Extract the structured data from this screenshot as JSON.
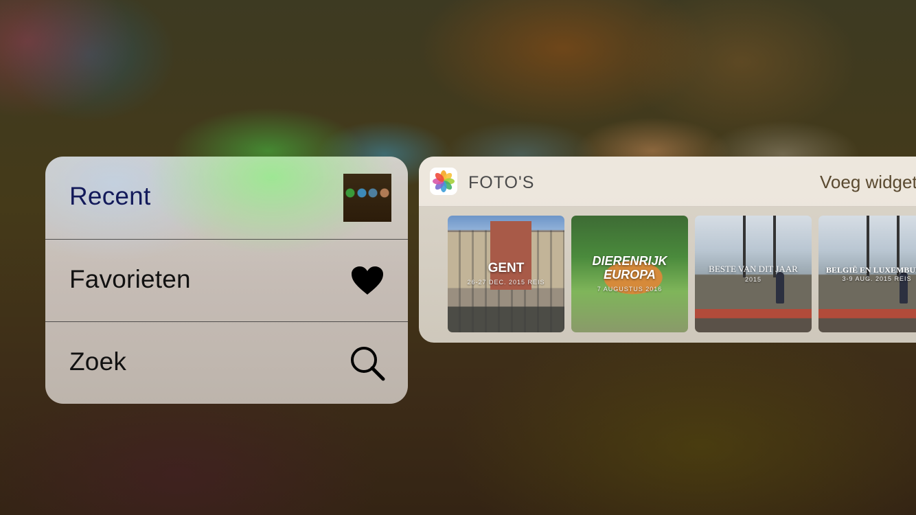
{
  "menu": {
    "items": [
      {
        "label": "Recent",
        "icon": "recent-photo-thumbnail"
      },
      {
        "label": "Favorieten",
        "icon": "heart-icon"
      },
      {
        "label": "Zoek",
        "icon": "search-icon"
      }
    ]
  },
  "widget": {
    "app_name": "FOTO'S",
    "action_label": "Voeg widget toe",
    "albums": [
      {
        "title": "GENT",
        "subtitle": "26-27 DEC. 2015 REIS"
      },
      {
        "title": "DIERENRIJK EUROPA",
        "subtitle": "7 AUGUSTUS 2016"
      },
      {
        "title": "BESTE VAN DIT JAAR",
        "subtitle": "2015"
      },
      {
        "title": "BELGIË EN LUXEMBURG",
        "subtitle": "3-9 AUG. 2015 REIS"
      }
    ]
  },
  "colors": {
    "menu_text": "#111111",
    "recent_text": "#131a5a",
    "widget_action": "#5a4a30"
  }
}
